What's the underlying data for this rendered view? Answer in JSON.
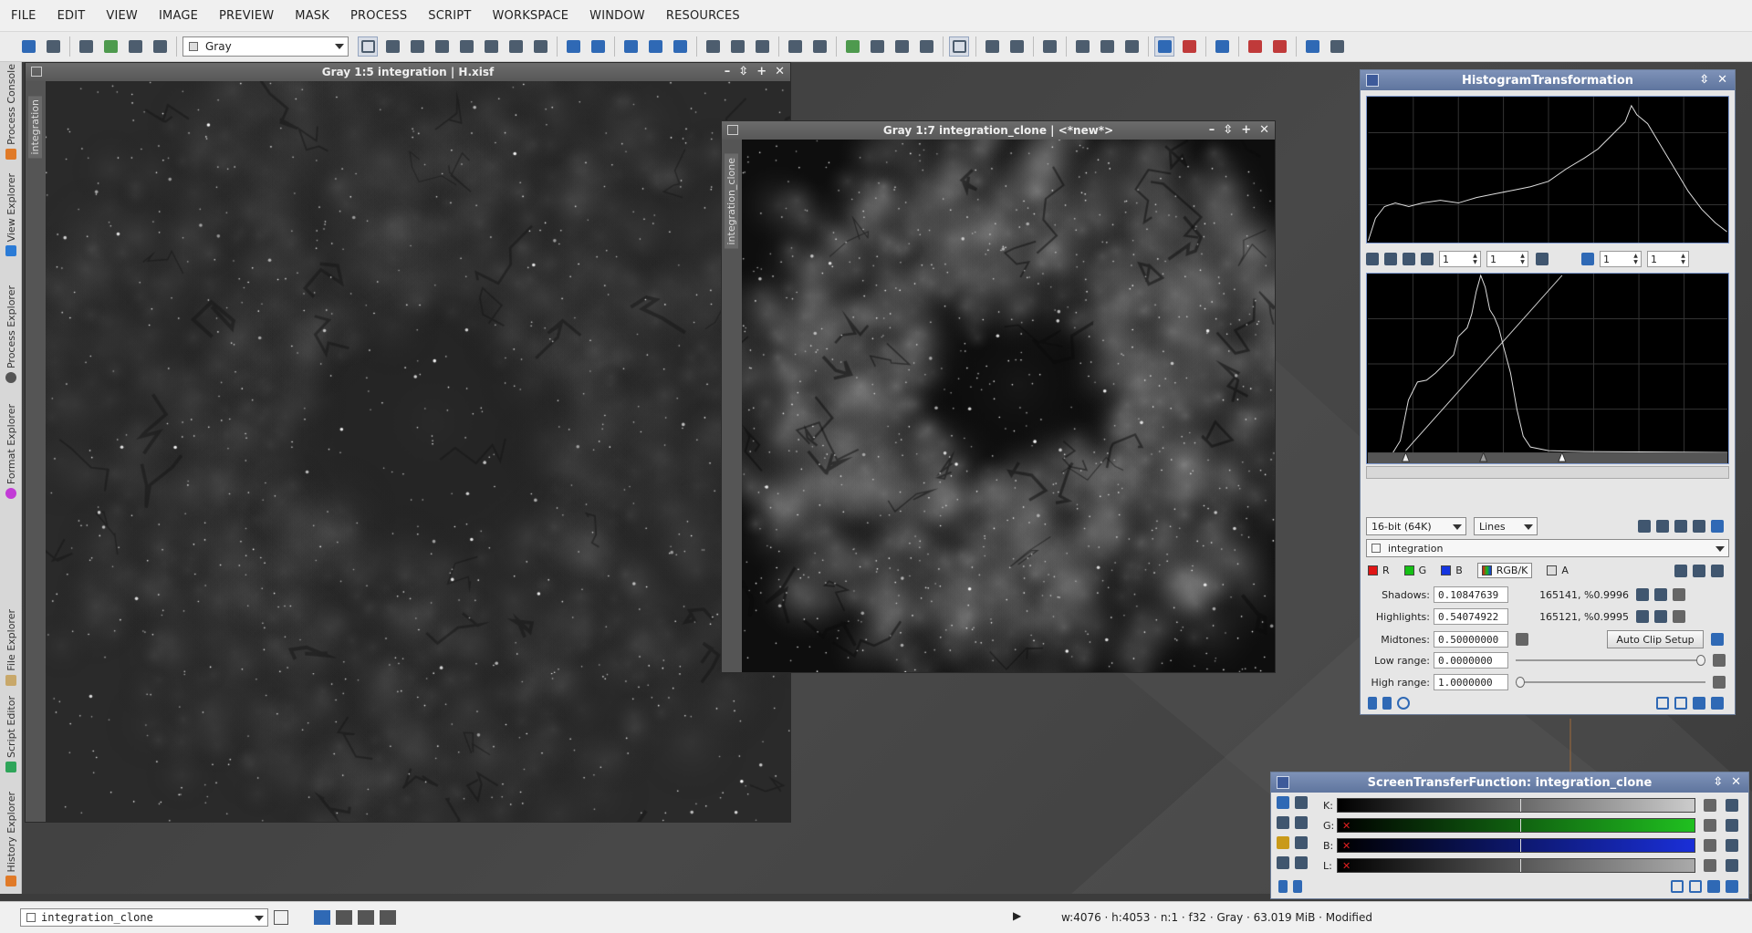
{
  "menu": [
    "FILE",
    "EDIT",
    "VIEW",
    "IMAGE",
    "PREVIEW",
    "MASK",
    "PROCESS",
    "SCRIPT",
    "WORKSPACE",
    "WINDOW",
    "RESOURCES"
  ],
  "toolbar": {
    "mode_select": "Gray"
  },
  "left_dock": [
    "Process Console",
    "View Explorer",
    "Process Explorer",
    "Format Explorer",
    "File Explorer",
    "Script Editor",
    "History Explorer"
  ],
  "windows": {
    "main": {
      "title": "Gray 1:5 integration | H.xisf",
      "side_label": "integration"
    },
    "clone": {
      "title": "Gray 1:7 integration_clone | <*new*>",
      "side_label": "integration_clone"
    }
  },
  "histogram": {
    "title": "HistogramTransformation",
    "zoom": [
      "1",
      "1",
      "1",
      "1"
    ],
    "resolution": "16-bit (64K)",
    "graph_style": "Lines",
    "target_view": "integration",
    "channels": [
      "R",
      "G",
      "B",
      "RGB/K",
      "A"
    ],
    "shadows_label": "Shadows:",
    "shadows_value": "0.10847639",
    "shadows_readout": "165141, %0.9996",
    "highlights_label": "Highlights:",
    "highlights_value": "0.54074922",
    "highlights_readout": "165121, %0.9995",
    "midtones_label": "Midtones:",
    "midtones_value": "0.50000000",
    "auto_clip_label": "Auto Clip Setup",
    "low_range_label": "Low range:",
    "low_range_value": "0.0000000",
    "high_range_label": "High range:",
    "high_range_value": "1.0000000"
  },
  "stf": {
    "title": "ScreenTransferFunction: integration_clone",
    "rows": [
      {
        "label": "K:",
        "color": "#cccccc"
      },
      {
        "label": "G:",
        "color": "#20c020"
      },
      {
        "label": "B:",
        "color": "#1a2fd8"
      },
      {
        "label": "L:",
        "color": "#aaaaaa"
      }
    ]
  },
  "statusbar": {
    "view_name": "integration_clone",
    "info": "w:4076  ·  h:4053  ·  n:1  ·  f32  ·  Gray  ·  63.019 MiB  ·  Modified"
  }
}
